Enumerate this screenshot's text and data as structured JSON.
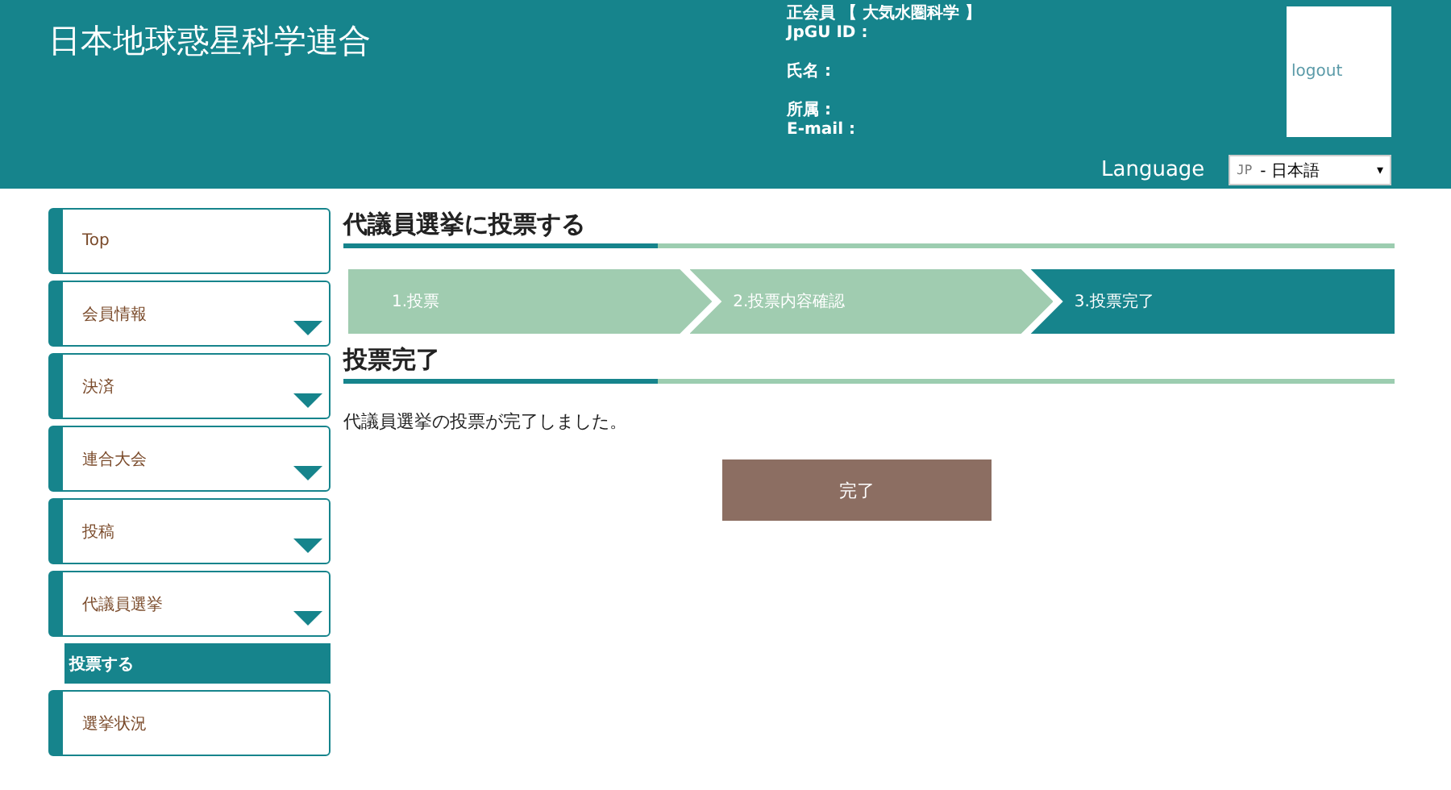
{
  "header": {
    "site_title": "日本地球惑星科学連合",
    "member_type": "正会員 【 大気水圏科学 】",
    "fields": [
      {
        "label": "JpGU ID :"
      },
      {
        "label": "氏名 :"
      },
      {
        "label": "所属 :"
      },
      {
        "label": "E-mail :"
      }
    ],
    "logout": "logout",
    "language_label": "Language",
    "language": {
      "code": "JP",
      "label": "- 日本語",
      "caret": "▾"
    }
  },
  "sidebar": {
    "items": [
      {
        "label": "Top",
        "expandable": false
      },
      {
        "label": "会員情報",
        "expandable": true
      },
      {
        "label": "決済",
        "expandable": true
      },
      {
        "label": "連合大会",
        "expandable": true
      },
      {
        "label": "投稿",
        "expandable": true
      },
      {
        "label": "代議員選挙",
        "expandable": true,
        "children": [
          {
            "label": "投票する",
            "selected": true
          }
        ]
      },
      {
        "label": "選挙状況",
        "expandable": false
      }
    ]
  },
  "main": {
    "title": "代議員選挙に投票する",
    "steps": [
      {
        "label": "1.投票",
        "selected": false
      },
      {
        "label": "2.投票内容確認",
        "selected": false
      },
      {
        "label": "3.投票完了",
        "selected": true
      }
    ],
    "section_title": "投票完了",
    "message": "代議員選挙の投票が完了しました。",
    "button": "完了"
  }
}
